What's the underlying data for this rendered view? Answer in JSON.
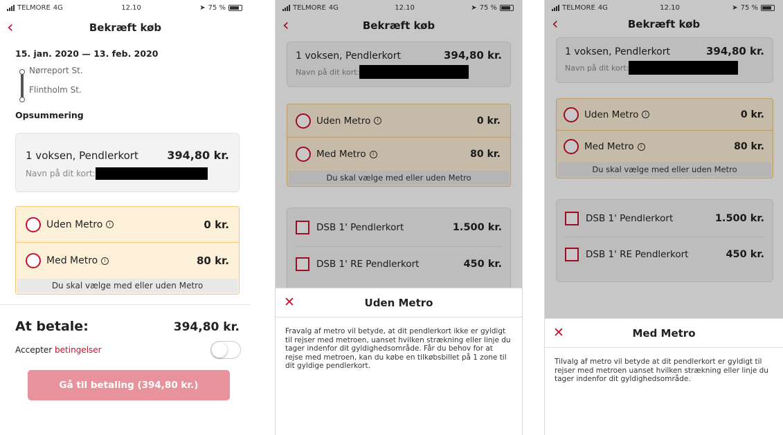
{
  "status": {
    "carrier": "TELMORE",
    "network": "4G",
    "time": "12.10",
    "battery": "75 %"
  },
  "nav": {
    "title": "Bekræft køb"
  },
  "trip": {
    "dates": "15. jan. 2020 — 13. feb. 2020",
    "from": "Nørreport St.",
    "to": "Flintholm St."
  },
  "summary": {
    "heading": "Opsummering"
  },
  "product": {
    "name": "1 voksen, Pendlerkort",
    "price": "394,80 kr.",
    "card_name_label": "Navn på dit kort:"
  },
  "metro": {
    "without_label": "Uden Metro",
    "without_price": "0 kr.",
    "with_label": "Med Metro",
    "with_price": "80 kr.",
    "note": "Du skal vælge med eller uden Metro"
  },
  "addons": [
    {
      "label": "DSB 1' Pendlerkort",
      "price": "1.500 kr."
    },
    {
      "label": "DSB 1' RE Pendlerkort",
      "price": "450 kr."
    }
  ],
  "payment": {
    "label": "At betale:",
    "amount": "394,80 kr.",
    "accept_prefix": "Accepter",
    "accept_link": "betingelser",
    "button": "Gå til betaling (394,80 kr.)"
  },
  "sheet_without": {
    "title": "Uden Metro",
    "text": "Fravalg af metro vil betyde, at dit pendlerkort ikke er gyldigt til rejser med metroen, uanset hvilken strækning eller linje du tager indenfor dit gyldighedsområde. Får du behov for at rejse med metroen, kan du købe en tilkøbsbillet på 1 zone til dit gyldige pendlerkort."
  },
  "sheet_with": {
    "title": "Med Metro",
    "text": "Tilvalg af metro vil betyde at dit pendlerkort er gyldigt til rejser med metroen uanset hvilken strækning eller linje du tager indenfor dit gyldighedsområde."
  },
  "colors": {
    "accent": "#c8102e",
    "option_bg": "#fdf0d8",
    "option_border": "#f0c882",
    "button_disabled": "#e8929d"
  }
}
